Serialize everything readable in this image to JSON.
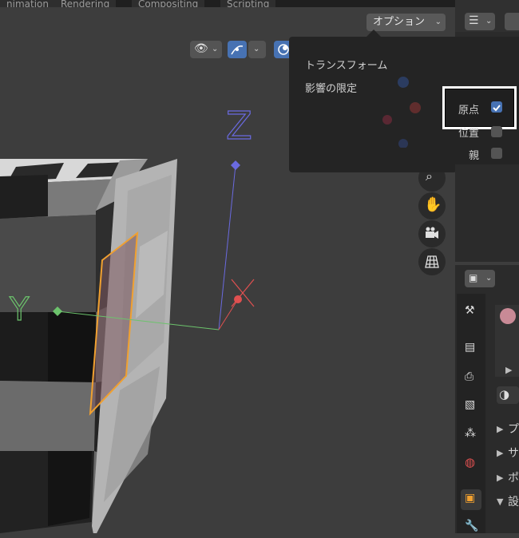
{
  "workspace_tabs": [
    "nimation",
    "Rendering",
    "Compositing",
    "Scripting"
  ],
  "viewport": {
    "options_label": "オプション",
    "axis_z": "Z",
    "axis_y": "Y"
  },
  "options_popover": {
    "items": [
      "トランスフォーム",
      "影響の限定"
    ],
    "checkboxes": [
      {
        "label": "原点",
        "checked": true
      },
      {
        "label": "位置",
        "checked": false
      },
      {
        "label": "親",
        "checked": false
      }
    ]
  },
  "properties_sections": [
    {
      "label": "プ"
    },
    {
      "label": "サ"
    },
    {
      "label": "ポ"
    },
    {
      "label": "設"
    }
  ],
  "colors": {
    "accent_blue": "#4772b3",
    "selection_orange": "#f0a030",
    "axis_z": "#6a6ae0",
    "axis_y": "#6cc36c",
    "axis_x": "#e05050"
  },
  "icons": [
    "visibility-icon",
    "gizmo-icon",
    "overlay-icon",
    "zoom-icon",
    "hand-icon",
    "camera-icon",
    "grid-icon",
    "outliner-icon",
    "tool-icon",
    "render-icon",
    "output-icon",
    "image-icon",
    "particles-icon",
    "world-icon",
    "object-icon",
    "wrench-icon"
  ]
}
